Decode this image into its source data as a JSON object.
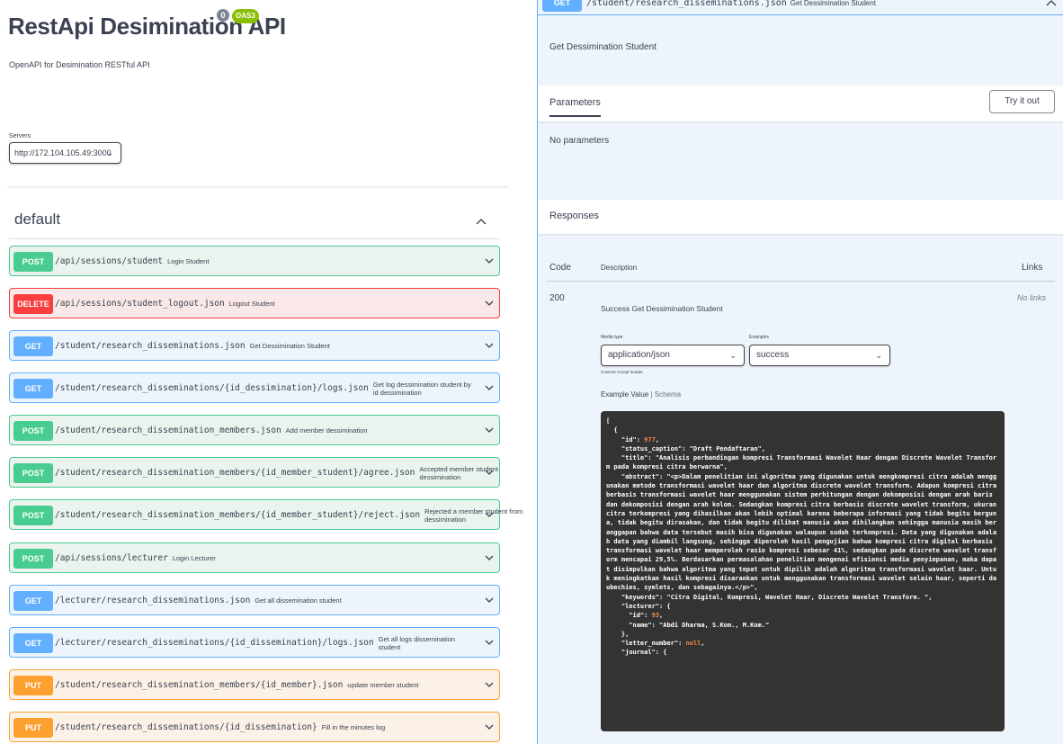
{
  "info": {
    "title": "RestApi Desimination API",
    "version_badge": "0",
    "oas_badge": "OAS3",
    "description": "OpenAPI for Desimination RESTful API"
  },
  "servers": {
    "label": "Servers",
    "selected": "http://172.104.105.49:3000"
  },
  "tag": {
    "name": "default"
  },
  "operations": [
    {
      "method": "POST",
      "path": "/api/sessions/student",
      "summary": "Login Student"
    },
    {
      "method": "DELETE",
      "path": "/api/sessions/student_logout.json",
      "summary": "Logout Student"
    },
    {
      "method": "GET",
      "path": "/student/research_disseminations.json",
      "summary": "Get Dessimination Student"
    },
    {
      "method": "GET",
      "path": "/student/research_disseminations/{id_dessimination}/logs.json",
      "summary": "Get log dessimination student by id dessimination"
    },
    {
      "method": "POST",
      "path": "/student/research_dissemination_members.json",
      "summary": "Add member dessimination"
    },
    {
      "method": "POST",
      "path": "/student/research_dissemination_members/{id_member_student}/agree.json",
      "summary": "Accepted member student dessimination"
    },
    {
      "method": "POST",
      "path": "/student/research_dissemination_members/{id_member_student}/reject.json",
      "summary": "Rejected a member student from dessimination"
    },
    {
      "method": "POST",
      "path": "/api/sessions/lecturer",
      "summary": "Login Lecturer"
    },
    {
      "method": "GET",
      "path": "/lecturer/research_disseminations.json",
      "summary": "Get all dissemination student"
    },
    {
      "method": "GET",
      "path": "/lecturer/research_disseminations/{id_dissemination}/logs.json",
      "summary": "Get all logs dissemination student"
    },
    {
      "method": "PUT",
      "path": "/student/research_dissemination_members/{id_member}.json",
      "summary": "update member student"
    },
    {
      "method": "PUT",
      "path": "/student/research_disseminations/{id_dissemination}",
      "summary": "Fill in the minutes log"
    }
  ],
  "detail": {
    "method": "GET",
    "path": "/student/research_disseminations.json",
    "summary": "Get Dessimination Student",
    "description": "Get Dessimination Student",
    "parameters_label": "Parameters",
    "try_button": "Try it out",
    "no_params": "No parameters",
    "responses_label": "Responses",
    "col_code": "Code",
    "col_description": "Description",
    "col_links": "Links",
    "response_code": "200",
    "response_description": "Success Get Dessimination Student",
    "response_links": "No links",
    "media_type_label": "Media type",
    "media_type": "application/json",
    "examples_label": "Examples",
    "example": "success",
    "controls_accept": "Controls Accept header.",
    "tab_example": "Example Value",
    "tab_separator": "|",
    "tab_schema": "Schema",
    "json_lines": [
      "[",
      "  {",
      "    \"id\": 977,",
      "    \"status_caption\": \"Draft Pendaftaran\",",
      "    \"title\": \"Analisis perbandingan kompresi Transformasi Wavelet Haar dengan Discrete Wavelet Transform pada kompresi citra berwarna\",",
      "    \"abstract\": \"<p>Dalam penelitian ini algoritma yang digunakan untuk mengkompresi citra adalah menggunakan metode transformasi wavelet haar dan algoritma discrete wavelet transform. Adapun kompresi citra berbasis transformasi wavelet haar menggunakan sistem perhitungan dengan dekomposisi dengan arah baris dan dekomposisi dengan arah kolom. Sedangkan kompresi citra berbasis discrete wavelet transform, ukuran citra terkompresi yang dihasilkan akan lebih optimal karena beberapa informasi yang tidak begitu berguna, tidak begitu dirasakan, dan tidak begitu dilihat manusia akan dihilangkan sehingga manusia masih beranggapan bahwa data tersebut masih bisa digunakan walaupun sudah terkompresi. Data yang digunakan adalah data yang diambil langsung, sehingga diperoleh hasil pengujian bahwa kompresi citra digital berbasis transformasi wavelet haar memperoleh rasio kompresi sebesar 41%, sedangkan pada discrete wavelet transform mencapai 29,5%. Berdasarkan permasalahan penelitian mengenai efisiensi media penyimpanan, maka dapat disimpulkan bahwa algoritma yang tepat untuk dipilih adalah algoritma transformasi wavelet haar. Untuk meningkatkan hasil kompresi disarankan untuk menggunakan transformasi wavelet selain haar, seperti daubechies, symlets, dan sebagainya.</p>\",",
      "    \"keywords\": \"Citra Digital, Kompresi, Wavelet Haar, Discrete Wavelet Transform. \",",
      "    \"lecturer\": {",
      "      \"id\": 93,",
      "      \"name\": \"Abdi Dharma, S.Kom., M.Kom.\"",
      "    },",
      "    \"letter_number\": null,",
      "    \"journal\": {"
    ]
  },
  "colors": {
    "post": "#49cc90",
    "get": "#61affe",
    "delete": "#f93e3e",
    "put": "#fca130"
  },
  "icons": {
    "expand": "chevron-down-icon",
    "collapse": "chevron-up-icon"
  }
}
